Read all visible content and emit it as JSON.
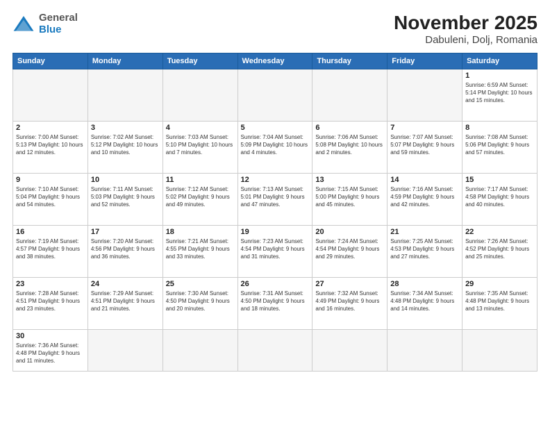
{
  "logo": {
    "general": "General",
    "blue": "Blue"
  },
  "title": "November 2025",
  "subtitle": "Dabuleni, Dolj, Romania",
  "days_of_week": [
    "Sunday",
    "Monday",
    "Tuesday",
    "Wednesday",
    "Thursday",
    "Friday",
    "Saturday"
  ],
  "weeks": [
    [
      {
        "day": "",
        "info": ""
      },
      {
        "day": "",
        "info": ""
      },
      {
        "day": "",
        "info": ""
      },
      {
        "day": "",
        "info": ""
      },
      {
        "day": "",
        "info": ""
      },
      {
        "day": "",
        "info": ""
      },
      {
        "day": "1",
        "info": "Sunrise: 6:59 AM\nSunset: 5:14 PM\nDaylight: 10 hours\nand 15 minutes."
      }
    ],
    [
      {
        "day": "2",
        "info": "Sunrise: 7:00 AM\nSunset: 5:13 PM\nDaylight: 10 hours\nand 12 minutes."
      },
      {
        "day": "3",
        "info": "Sunrise: 7:02 AM\nSunset: 5:12 PM\nDaylight: 10 hours\nand 10 minutes."
      },
      {
        "day": "4",
        "info": "Sunrise: 7:03 AM\nSunset: 5:10 PM\nDaylight: 10 hours\nand 7 minutes."
      },
      {
        "day": "5",
        "info": "Sunrise: 7:04 AM\nSunset: 5:09 PM\nDaylight: 10 hours\nand 4 minutes."
      },
      {
        "day": "6",
        "info": "Sunrise: 7:06 AM\nSunset: 5:08 PM\nDaylight: 10 hours\nand 2 minutes."
      },
      {
        "day": "7",
        "info": "Sunrise: 7:07 AM\nSunset: 5:07 PM\nDaylight: 9 hours\nand 59 minutes."
      },
      {
        "day": "8",
        "info": "Sunrise: 7:08 AM\nSunset: 5:06 PM\nDaylight: 9 hours\nand 57 minutes."
      }
    ],
    [
      {
        "day": "9",
        "info": "Sunrise: 7:10 AM\nSunset: 5:04 PM\nDaylight: 9 hours\nand 54 minutes."
      },
      {
        "day": "10",
        "info": "Sunrise: 7:11 AM\nSunset: 5:03 PM\nDaylight: 9 hours\nand 52 minutes."
      },
      {
        "day": "11",
        "info": "Sunrise: 7:12 AM\nSunset: 5:02 PM\nDaylight: 9 hours\nand 49 minutes."
      },
      {
        "day": "12",
        "info": "Sunrise: 7:13 AM\nSunset: 5:01 PM\nDaylight: 9 hours\nand 47 minutes."
      },
      {
        "day": "13",
        "info": "Sunrise: 7:15 AM\nSunset: 5:00 PM\nDaylight: 9 hours\nand 45 minutes."
      },
      {
        "day": "14",
        "info": "Sunrise: 7:16 AM\nSunset: 4:59 PM\nDaylight: 9 hours\nand 42 minutes."
      },
      {
        "day": "15",
        "info": "Sunrise: 7:17 AM\nSunset: 4:58 PM\nDaylight: 9 hours\nand 40 minutes."
      }
    ],
    [
      {
        "day": "16",
        "info": "Sunrise: 7:19 AM\nSunset: 4:57 PM\nDaylight: 9 hours\nand 38 minutes."
      },
      {
        "day": "17",
        "info": "Sunrise: 7:20 AM\nSunset: 4:56 PM\nDaylight: 9 hours\nand 36 minutes."
      },
      {
        "day": "18",
        "info": "Sunrise: 7:21 AM\nSunset: 4:55 PM\nDaylight: 9 hours\nand 33 minutes."
      },
      {
        "day": "19",
        "info": "Sunrise: 7:23 AM\nSunset: 4:54 PM\nDaylight: 9 hours\nand 31 minutes."
      },
      {
        "day": "20",
        "info": "Sunrise: 7:24 AM\nSunset: 4:54 PM\nDaylight: 9 hours\nand 29 minutes."
      },
      {
        "day": "21",
        "info": "Sunrise: 7:25 AM\nSunset: 4:53 PM\nDaylight: 9 hours\nand 27 minutes."
      },
      {
        "day": "22",
        "info": "Sunrise: 7:26 AM\nSunset: 4:52 PM\nDaylight: 9 hours\nand 25 minutes."
      }
    ],
    [
      {
        "day": "23",
        "info": "Sunrise: 7:28 AM\nSunset: 4:51 PM\nDaylight: 9 hours\nand 23 minutes."
      },
      {
        "day": "24",
        "info": "Sunrise: 7:29 AM\nSunset: 4:51 PM\nDaylight: 9 hours\nand 21 minutes."
      },
      {
        "day": "25",
        "info": "Sunrise: 7:30 AM\nSunset: 4:50 PM\nDaylight: 9 hours\nand 20 minutes."
      },
      {
        "day": "26",
        "info": "Sunrise: 7:31 AM\nSunset: 4:50 PM\nDaylight: 9 hours\nand 18 minutes."
      },
      {
        "day": "27",
        "info": "Sunrise: 7:32 AM\nSunset: 4:49 PM\nDaylight: 9 hours\nand 16 minutes."
      },
      {
        "day": "28",
        "info": "Sunrise: 7:34 AM\nSunset: 4:48 PM\nDaylight: 9 hours\nand 14 minutes."
      },
      {
        "day": "29",
        "info": "Sunrise: 7:35 AM\nSunset: 4:48 PM\nDaylight: 9 hours\nand 13 minutes."
      }
    ],
    [
      {
        "day": "30",
        "info": "Sunrise: 7:36 AM\nSunset: 4:48 PM\nDaylight: 9 hours\nand 11 minutes."
      },
      {
        "day": "",
        "info": ""
      },
      {
        "day": "",
        "info": ""
      },
      {
        "day": "",
        "info": ""
      },
      {
        "day": "",
        "info": ""
      },
      {
        "day": "",
        "info": ""
      },
      {
        "day": "",
        "info": ""
      }
    ]
  ]
}
